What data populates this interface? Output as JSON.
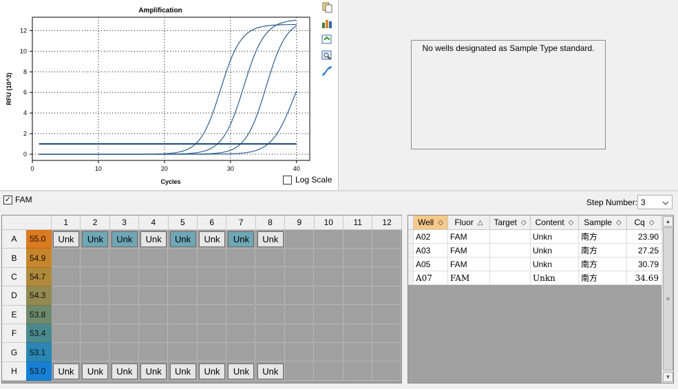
{
  "chart_data": {
    "type": "line",
    "title": "Amplification",
    "xlabel": "Cycles",
    "ylabel": "RFU (10^3)",
    "xlim": [
      0,
      42
    ],
    "ylim": [
      -0.6,
      13.3
    ],
    "xticks": [
      0,
      10,
      20,
      30,
      40
    ],
    "yticks": [
      0,
      2,
      4,
      6,
      8,
      10,
      12
    ],
    "grid": true,
    "threshold": 1.0,
    "series": [
      {
        "well": "A02",
        "cq": 23.9,
        "plateau": 12.6,
        "midpoint": 28.5,
        "slope": 1.55
      },
      {
        "well": "A03",
        "cq": 27.25,
        "plateau": 13.1,
        "midpoint": 32.0,
        "slope": 1.6
      },
      {
        "well": "A05",
        "cq": 30.79,
        "plateau": 13.1,
        "midpoint": 35.4,
        "slope": 1.55
      },
      {
        "well": "A07",
        "cq": 34.69,
        "plateau": 11.0,
        "midpoint": 39.6,
        "slope": 1.7
      }
    ],
    "x_start": 1,
    "x_end": 40
  },
  "chart": {
    "log_scale_label": "Log Scale",
    "log_scale_checked": false,
    "tools": [
      "copy-icon",
      "export-icon",
      "refresh-icon",
      "zoom-icon",
      "curve-icon"
    ]
  },
  "std_curve": {
    "message": "No wells designated as Sample Type standard."
  },
  "fluor": {
    "label": "FAM",
    "checked": true
  },
  "step": {
    "label": "Step Number:",
    "value": "3"
  },
  "plate": {
    "columns": [
      "1",
      "2",
      "3",
      "4",
      "5",
      "6",
      "7",
      "8",
      "9",
      "10",
      "11",
      "12"
    ],
    "rows": [
      {
        "label": "A",
        "temp": "55.0",
        "color": "#dc7a1e",
        "wells": [
          "Unk",
          "Unk",
          "Unk",
          "Unk",
          "Unk",
          "Unk",
          "Unk",
          "Unk"
        ],
        "selected": [
          false,
          true,
          true,
          false,
          true,
          false,
          true,
          false
        ]
      },
      {
        "label": "B",
        "temp": "54.9",
        "color": "#c8862c",
        "wells": [],
        "selected": []
      },
      {
        "label": "C",
        "temp": "54.7",
        "color": "#b08a3c",
        "wells": [],
        "selected": []
      },
      {
        "label": "D",
        "temp": "54.3",
        "color": "#928a50",
        "wells": [],
        "selected": []
      },
      {
        "label": "E",
        "temp": "53.8",
        "color": "#6e8a6c",
        "wells": [],
        "selected": []
      },
      {
        "label": "F",
        "temp": "53.4",
        "color": "#4a8a8e",
        "wells": [],
        "selected": []
      },
      {
        "label": "G",
        "temp": "53.1",
        "color": "#2a86b4",
        "wells": [],
        "selected": []
      },
      {
        "label": "H",
        "temp": "53.0",
        "color": "#1680d8",
        "wells": [
          "Unk",
          "Unk",
          "Unk",
          "Unk",
          "Unk",
          "Unk",
          "Unk",
          "Unk"
        ],
        "selected": [
          false,
          false,
          false,
          false,
          false,
          false,
          false,
          false
        ]
      }
    ]
  },
  "results_table": {
    "columns": [
      "Well",
      "Fluor",
      "Target",
      "Content",
      "Sample",
      "Cq"
    ],
    "rows": [
      [
        "A02",
        "FAM",
        "",
        "Unkn",
        "南方",
        "23.90"
      ],
      [
        "A03",
        "FAM",
        "",
        "Unkn",
        "南方",
        "27.25"
      ],
      [
        "A05",
        "FAM",
        "",
        "Unkn",
        "南方",
        "30.79"
      ],
      [
        "A07",
        "FAM",
        "",
        "Unkn",
        "南方",
        "34.69"
      ]
    ]
  }
}
